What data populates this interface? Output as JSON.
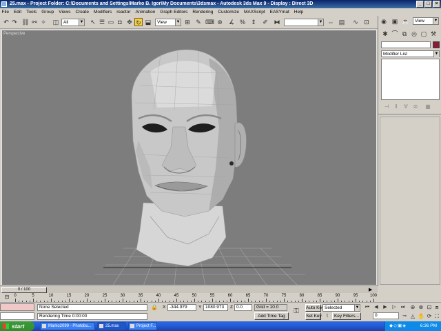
{
  "window": {
    "title": "25.max     - Project Folder: C:\\Documents and Settings\\Marko B. Igor\\My Documents\\3dsmax      - Autodesk 3ds Max 9       - Display : Direct 3D",
    "minimize": "_",
    "maximize": "□",
    "close": "×"
  },
  "menu": [
    "File",
    "Edit",
    "Tools",
    "Group",
    "Views",
    "Create",
    "Modifiers",
    "reactor",
    "Animation",
    "Graph Editors",
    "Rendering",
    "Customize",
    "MAXScript",
    "EASYmat",
    "Help"
  ],
  "toolbar": {
    "selection_filter": "All",
    "reference_coord": "View",
    "named_selection": "",
    "render_view": "View"
  },
  "viewport": {
    "label": "Perspective"
  },
  "command_panel": {
    "object_name": "",
    "object_color": "#8b1a3a",
    "modifier_list": "Modifier List"
  },
  "timeline": {
    "position": "0 / 100",
    "ticks": [
      "0",
      "5",
      "10",
      "15",
      "20",
      "25",
      "30",
      "35",
      "40",
      "45",
      "50",
      "55",
      "60",
      "65",
      "70",
      "75",
      "80",
      "85",
      "90",
      "95",
      "100"
    ]
  },
  "status": {
    "selection": "None Selected",
    "prompt": "Rendering Time  0:00:00",
    "x_label": "X",
    "x_value": "-344.979",
    "y_label": "Y",
    "y_value": "1080.973",
    "z_label": "Z",
    "z_value": "0.0",
    "grid": "Grid = 10.0",
    "add_time_tag": "Add Time Tag",
    "auto_key": "Auto Key",
    "set_key": "Set Key",
    "key_mode": "Selected",
    "key_filters": "Key Filters...",
    "frame": "0"
  },
  "taskbar": {
    "start": "start",
    "items": [
      "Marko2099 - Photobu...",
      "25.max",
      "Project F..."
    ],
    "clock": "6:36 PM"
  }
}
